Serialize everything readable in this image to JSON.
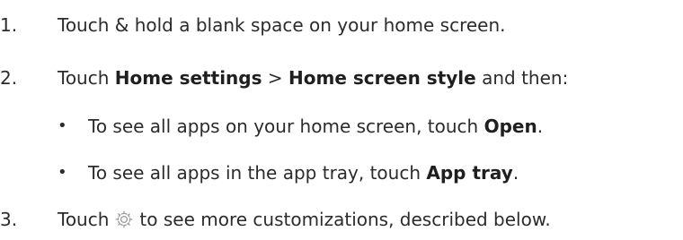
{
  "steps": [
    {
      "number": "1.",
      "text": "Touch & hold a blank space on your home screen."
    },
    {
      "number": "2.",
      "pre": "Touch ",
      "bold1": "Home settings",
      "mid": " > ",
      "bold2": "Home screen style",
      "post": " and then:",
      "bullets": [
        {
          "pre": "To see all apps on your home screen, touch ",
          "bold": "Open",
          "post": "."
        },
        {
          "pre": "To see all apps in the app tray, touch ",
          "bold": "App tray",
          "post": "."
        }
      ]
    },
    {
      "number": "3.",
      "pre": "Touch",
      "icon": "gear-icon",
      "post": "to see more customizations, described below."
    }
  ],
  "bullet_char": "•"
}
